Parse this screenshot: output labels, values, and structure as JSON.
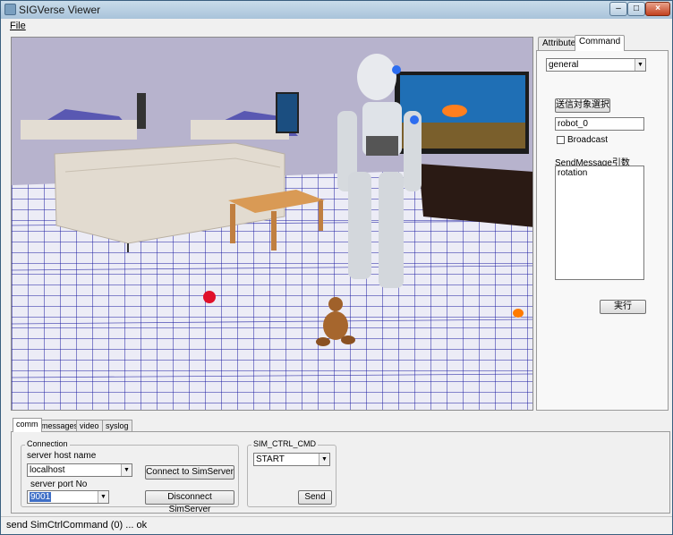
{
  "window": {
    "title": "SIGVerse Viewer",
    "minimize": "–",
    "maximize": "□",
    "close": "×"
  },
  "menu": {
    "file": "File"
  },
  "right_panel": {
    "tabs": [
      "Attributes",
      "Command"
    ],
    "active_tab": "Command",
    "mode_select": "general",
    "target_button": "送信対象選択",
    "target_value": "robot_0",
    "broadcast_label": "Broadcast",
    "send_message_label": "SendMessage引数",
    "send_message_value": "rotation",
    "execute_button": "実行"
  },
  "bottom_panel": {
    "tabs": [
      "comm",
      "messages",
      "video",
      "syslog"
    ],
    "active_tab": "comm",
    "connection": {
      "title": "Connection",
      "host_label": "server host name",
      "host_value": "localhost",
      "port_label": "server port No",
      "port_value": "9001",
      "connect_button": "Connect to SimServer",
      "disconnect_button": "Disconnect SimServer"
    },
    "sim_ctrl": {
      "title": "SIM_CTRL_CMD",
      "command_value": "START",
      "send_button": "Send"
    }
  },
  "status": {
    "text": "send SimCtrlCommand (0) ... ok"
  },
  "colors": {
    "floor_grid": "#1a1aa0",
    "floor": "#e8e8f4",
    "wall": "#b7b3cd",
    "titlebar": "#b9cfe2"
  }
}
